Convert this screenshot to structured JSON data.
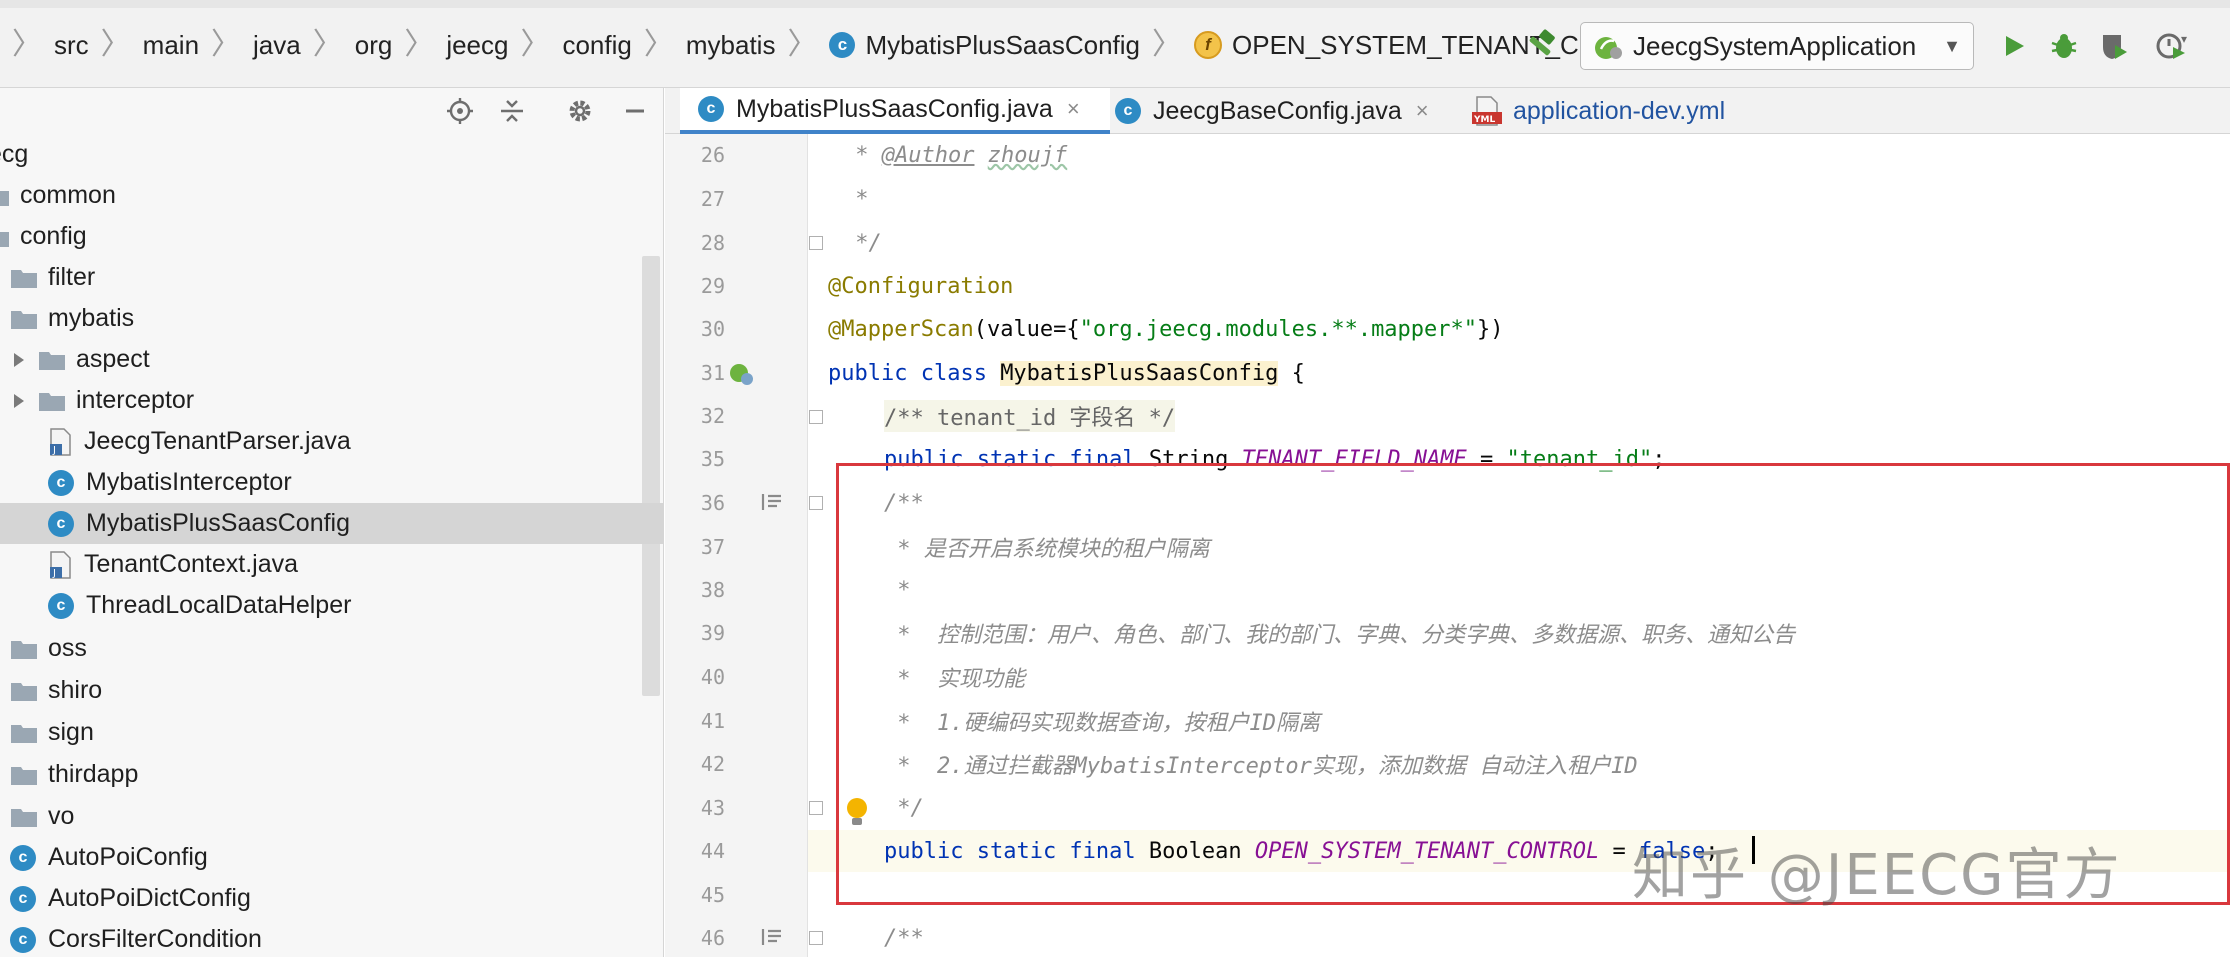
{
  "breadcrumb": {
    "items": [
      "src",
      "main",
      "java",
      "org",
      "jeecg",
      "config",
      "mybatis",
      "MybatisPlusSaasConfig",
      "OPEN_SYSTEM_TENANT_CONTROL"
    ]
  },
  "run_config": {
    "label": "JeecgSystemApplication"
  },
  "project_tree": {
    "nodes": [
      {
        "label": "ecg"
      },
      {
        "label": "common"
      },
      {
        "label": "config"
      },
      {
        "label": "filter"
      },
      {
        "label": "mybatis"
      },
      {
        "label": "aspect"
      },
      {
        "label": "interceptor"
      },
      {
        "label": "JeecgTenantParser.java"
      },
      {
        "label": "MybatisInterceptor"
      },
      {
        "label": "MybatisPlusSaasConfig"
      },
      {
        "label": "TenantContext.java"
      },
      {
        "label": "ThreadLocalDataHelper"
      },
      {
        "label": "oss"
      },
      {
        "label": "shiro"
      },
      {
        "label": "sign"
      },
      {
        "label": "thirdapp"
      },
      {
        "label": "vo"
      },
      {
        "label": "AutoPoiConfig"
      },
      {
        "label": "AutoPoiDictConfig"
      },
      {
        "label": "CorsFilterCondition"
      }
    ]
  },
  "tabs": [
    {
      "label": "MybatisPlusSaasConfig.java",
      "active": true
    },
    {
      "label": "JeecgBaseConfig.java",
      "active": false
    },
    {
      "label": "application-dev.yml",
      "active": false
    }
  ],
  "editor": {
    "line_numbers": [
      "26",
      "27",
      "28",
      "29",
      "30",
      "31",
      "32",
      "35",
      "36",
      "37",
      "38",
      "39",
      "40",
      "41",
      "42",
      "43",
      "44",
      "45",
      "46"
    ],
    "lines": {
      "l26_star": " * ",
      "l26_tag": "@Author",
      "l26_sp": " ",
      "l26_name": "zhoujf",
      "l27": " *",
      "l28": " */",
      "l29": "@Configuration",
      "l30_ann": "@MapperScan",
      "l30_a": "(value={",
      "l30_str": "\"org.jeecg.modules.**.mapper*\"",
      "l30_b": "})",
      "l31_kw": "public class ",
      "l31_cls": "MybatisPlusSaasConfig",
      "l31_b": " {",
      "l32": "/** tenant_id 字段名 */",
      "l35_kw": "public static final ",
      "l35_type": "String ",
      "l35_fld": "TENANT_FIELD_NAME",
      "l35_eq": " = ",
      "l35_str": "\"tenant_id\"",
      "l35_end": ";",
      "l36": "/**",
      "l37": " * 是否开启系统模块的租户隔离",
      "l38": " *",
      "l39": " *  控制范围：用户、角色、部门、我的部门、字典、分类字典、多数据源、职务、通知公告",
      "l40": " *  实现功能",
      "l41": " *  1.硬编码实现数据查询，按租户ID隔离",
      "l42": " *  2.通过拦截器MybatisInterceptor实现，添加数据 自动注入租户ID",
      "l43": " */",
      "l44_kw": "public static final ",
      "l44_type": "Boolean ",
      "l44_fld": "OPEN_SYSTEM_TENANT_CONTROL",
      "l44_eq": " = ",
      "l44_val": "false",
      "l44_end": ";",
      "l45": "",
      "l46": "/**"
    }
  },
  "watermark": "知乎 @JEECG官方",
  "colors": {
    "keyword": "#0033b3",
    "string": "#067d17",
    "field": "#871094",
    "annotation": "#8a7b00",
    "comment": "#8c8c8c",
    "highlight_box": "#d9383d",
    "class_icon": "#2e8bc4"
  }
}
